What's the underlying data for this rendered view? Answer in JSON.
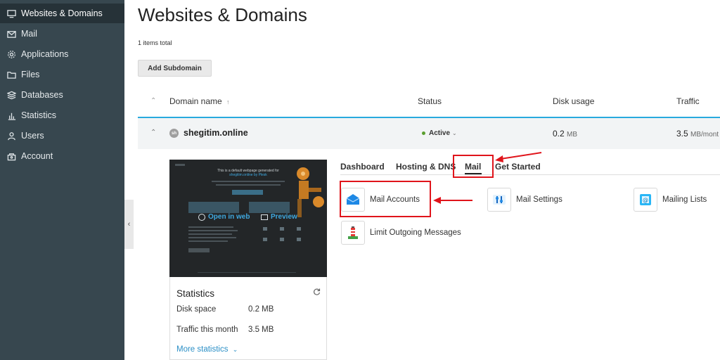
{
  "sidebar": {
    "items": [
      {
        "label": "Websites & Domains",
        "icon": "monitor-icon"
      },
      {
        "label": "Mail",
        "icon": "mail-icon"
      },
      {
        "label": "Applications",
        "icon": "gear-icon"
      },
      {
        "label": "Files",
        "icon": "folder-icon"
      },
      {
        "label": "Databases",
        "icon": "database-icon"
      },
      {
        "label": "Statistics",
        "icon": "bar-chart-icon"
      },
      {
        "label": "Users",
        "icon": "user-icon"
      },
      {
        "label": "Account",
        "icon": "account-icon"
      }
    ],
    "active": "Websites & Domains"
  },
  "page": {
    "title": "Websites & Domains",
    "items_total": "1 items total",
    "add_subdomain": "Add Subdomain"
  },
  "table": {
    "headers": {
      "domain": "Domain name",
      "sort_icon": "↑",
      "status": "Status",
      "disk": "Disk usage",
      "traffic": "Traffic"
    },
    "row": {
      "domain": "shegitim.online",
      "status": "Active",
      "disk_value": "0.2",
      "disk_unit": "MB",
      "traffic_value": "3.5",
      "traffic_unit": "MB/mont"
    }
  },
  "preview": {
    "text_line1": "This is a default webpage generated for",
    "text_line2": "shegitim.online by Plesk",
    "open_in_web": "Open in web",
    "preview": "Preview"
  },
  "stats": {
    "title": "Statistics",
    "disk_label": "Disk space",
    "disk_value": "0.2 MB",
    "traffic_label": "Traffic this month",
    "traffic_value": "3.5 MB",
    "more": "More statistics"
  },
  "tabs": [
    {
      "label": "Dashboard"
    },
    {
      "label": "Hosting & DNS"
    },
    {
      "label": "Mail"
    },
    {
      "label": "Get Started"
    }
  ],
  "active_tab": "Mail",
  "tools": {
    "mail_accounts": "Mail Accounts",
    "mail_settings": "Mail Settings",
    "mailing_lists": "Mailing Lists",
    "limit_outgoing": "Limit Outgoing Messages"
  },
  "colors": {
    "sidebar": "#37474f",
    "sidebar_active": "#263238",
    "accent": "#28aade",
    "highlight": "#e0141b",
    "link": "#2b8fc6"
  }
}
